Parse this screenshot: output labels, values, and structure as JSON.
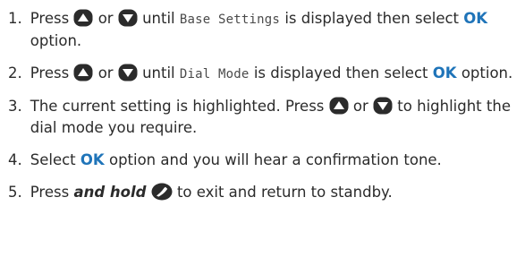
{
  "instructions": {
    "steps": [
      {
        "number": "1.",
        "t1": "Press",
        "t2": "or",
        "t3": "until",
        "display": "Base Settings",
        "t4": "is displayed then select",
        "ok": "OK",
        "t5": "option."
      },
      {
        "number": "2.",
        "t1": "Press",
        "t2": "or",
        "t3": "until",
        "display": "Dial Mode",
        "t4": "is displayed then select",
        "ok": "OK",
        "t5": "option."
      },
      {
        "number": "3.",
        "t1": "The current setting is highlighted. Press",
        "t2": "or",
        "t3": "to highlight the dial mode you require."
      },
      {
        "number": "4.",
        "t1": "Select",
        "ok": "OK",
        "t2": "option and you will hear a confirmation tone."
      },
      {
        "number": "5.",
        "t1": "Press",
        "em": "and hold",
        "t2": "to exit and return to standby."
      }
    ]
  },
  "icons": {
    "up": "up-arrow-key-icon",
    "down": "down-arrow-key-icon",
    "end": "end-call-handset-icon"
  },
  "colors": {
    "text": "#2b2b2b",
    "ok": "#1f74b9",
    "key": "#2b2b2b"
  }
}
